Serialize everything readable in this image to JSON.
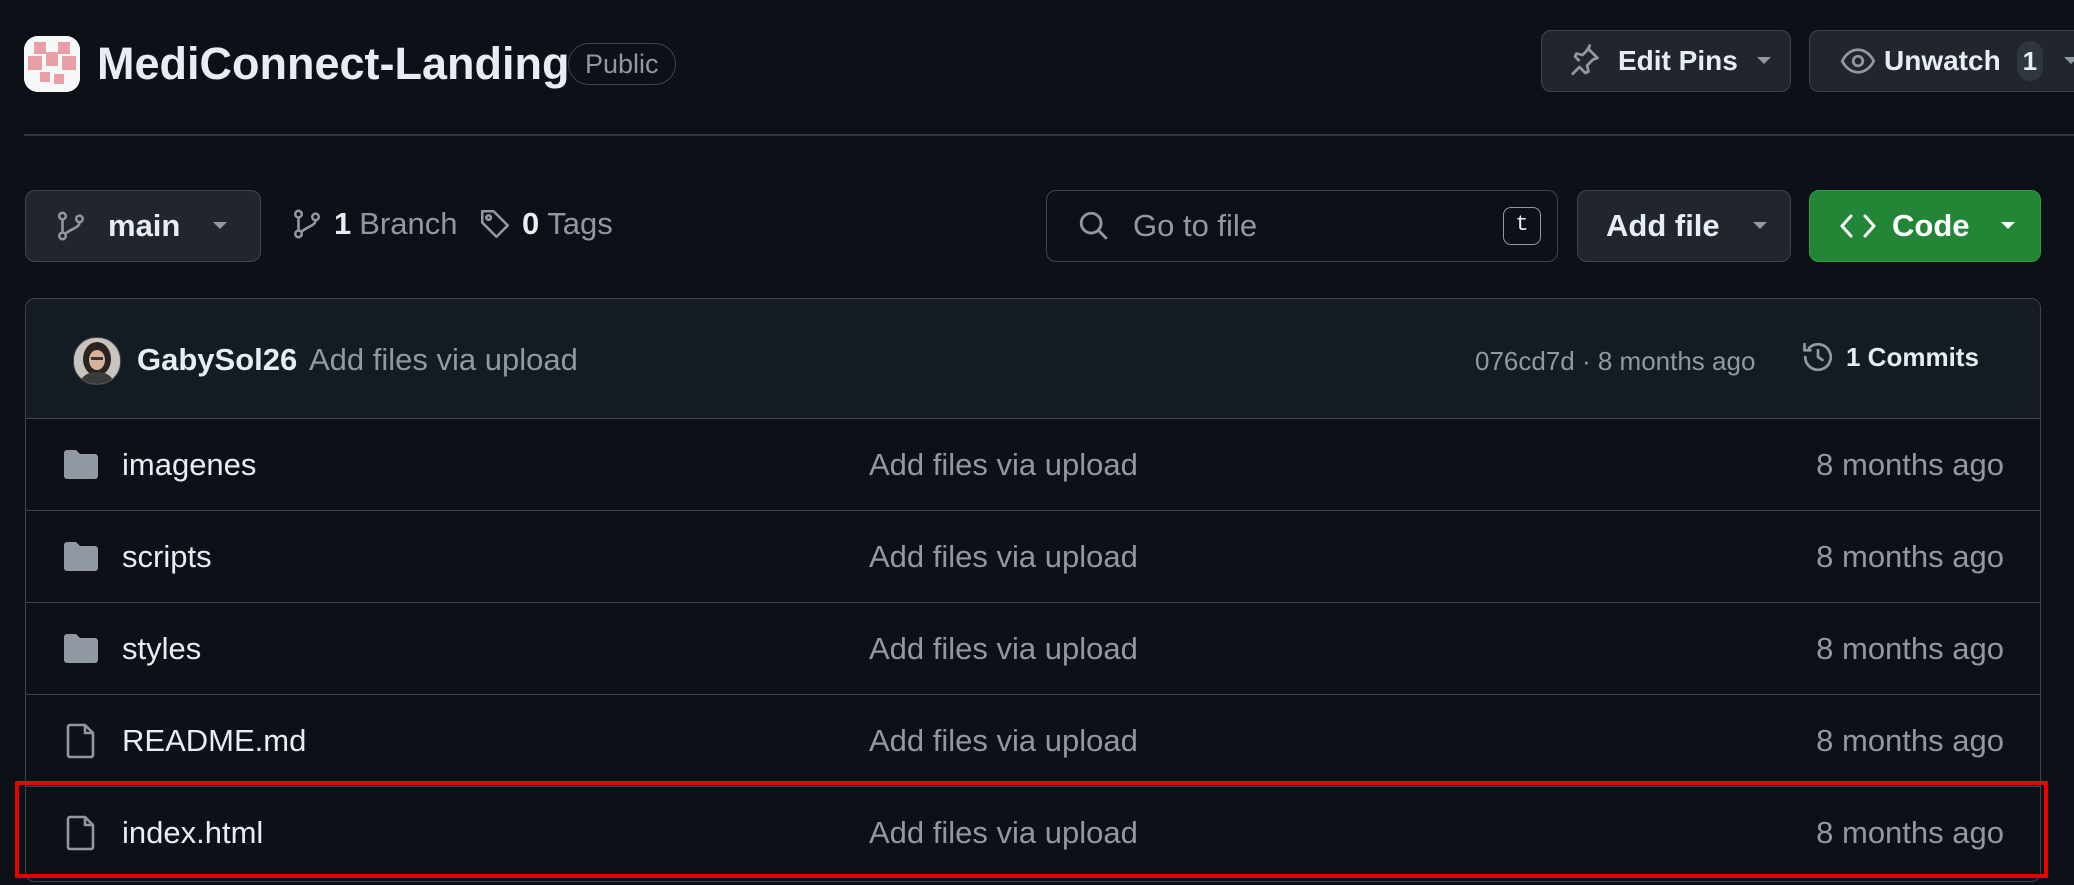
{
  "repo": {
    "name": "MediConnect-Landing",
    "visibility": "Public"
  },
  "header_actions": {
    "edit_pins_label": "Edit Pins",
    "unwatch_label": "Unwatch",
    "unwatch_count": "1"
  },
  "toolbar": {
    "branch": "main",
    "branch_count": "1",
    "branch_label": "Branch",
    "tag_count": "0",
    "tag_label": "Tags",
    "search_placeholder": "Go to file",
    "search_shortcut": "t",
    "add_file_label": "Add file",
    "code_label": "Code"
  },
  "latest_commit": {
    "author": "GabySol26",
    "message": "Add files via upload",
    "hash_and_time": "076cd7d · 8 months ago",
    "commits_label": "1 Commits"
  },
  "files": [
    {
      "name": "imagenes",
      "type": "folder",
      "message": "Add files via upload",
      "age": "8 months ago"
    },
    {
      "name": "scripts",
      "type": "folder",
      "message": "Add files via upload",
      "age": "8 months ago"
    },
    {
      "name": "styles",
      "type": "folder",
      "message": "Add files via upload",
      "age": "8 months ago"
    },
    {
      "name": "README.md",
      "type": "file",
      "message": "Add files via upload",
      "age": "8 months ago"
    },
    {
      "name": "index.html",
      "type": "file",
      "message": "Add files via upload",
      "age": "8 months ago",
      "highlighted": true
    }
  ],
  "colors": {
    "background": "#0d1117",
    "border": "#3d444d",
    "muted_text": "#9198a1",
    "code_button": "#238636",
    "highlight_box": "#e60000"
  }
}
